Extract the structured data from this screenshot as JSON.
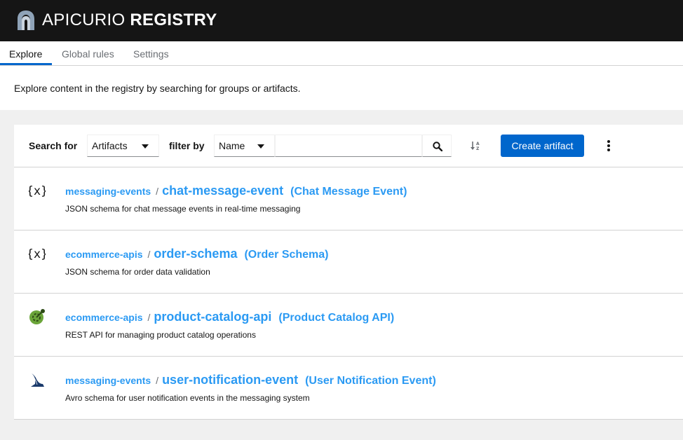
{
  "header": {
    "logo_light": "APICURIO",
    "logo_bold": "REGISTRY"
  },
  "tabs": [
    {
      "label": "Explore",
      "active": true
    },
    {
      "label": "Global rules",
      "active": false
    },
    {
      "label": "Settings",
      "active": false
    }
  ],
  "intro": {
    "text": "Explore content in the registry by searching for groups or artifacts."
  },
  "toolbar": {
    "search_for_label": "Search for",
    "search_for_value": "Artifacts",
    "filter_by_label": "filter by",
    "filter_by_value": "Name",
    "search_value": "",
    "create_label": "Create artifact",
    "icons": [
      "search-icon",
      "sort-ascending-icon",
      "kebab-menu-icon"
    ]
  },
  "artifacts": [
    {
      "group": "messaging-events",
      "id": "chat-message-event",
      "name": "(Chat Message Event)",
      "description": "JSON schema for chat message events in real-time messaging",
      "type_icon": "json-schema-icon"
    },
    {
      "group": "ecommerce-apis",
      "id": "order-schema",
      "name": "(Order Schema)",
      "description": "JSON schema for order data validation",
      "type_icon": "json-schema-icon"
    },
    {
      "group": "ecommerce-apis",
      "id": "product-catalog-api",
      "name": "(Product Catalog API)",
      "description": "REST API for managing product catalog operations",
      "type_icon": "openapi-icon"
    },
    {
      "group": "messaging-events",
      "id": "user-notification-event",
      "name": "(User Notification Event)",
      "description": "Avro schema for user notification events in the messaging system",
      "type_icon": "avro-icon"
    }
  ],
  "separator": "/",
  "colors": {
    "masthead": "#151515",
    "primary": "#0066cc",
    "link": "#2b9af3",
    "background": "#f0f0f0"
  }
}
